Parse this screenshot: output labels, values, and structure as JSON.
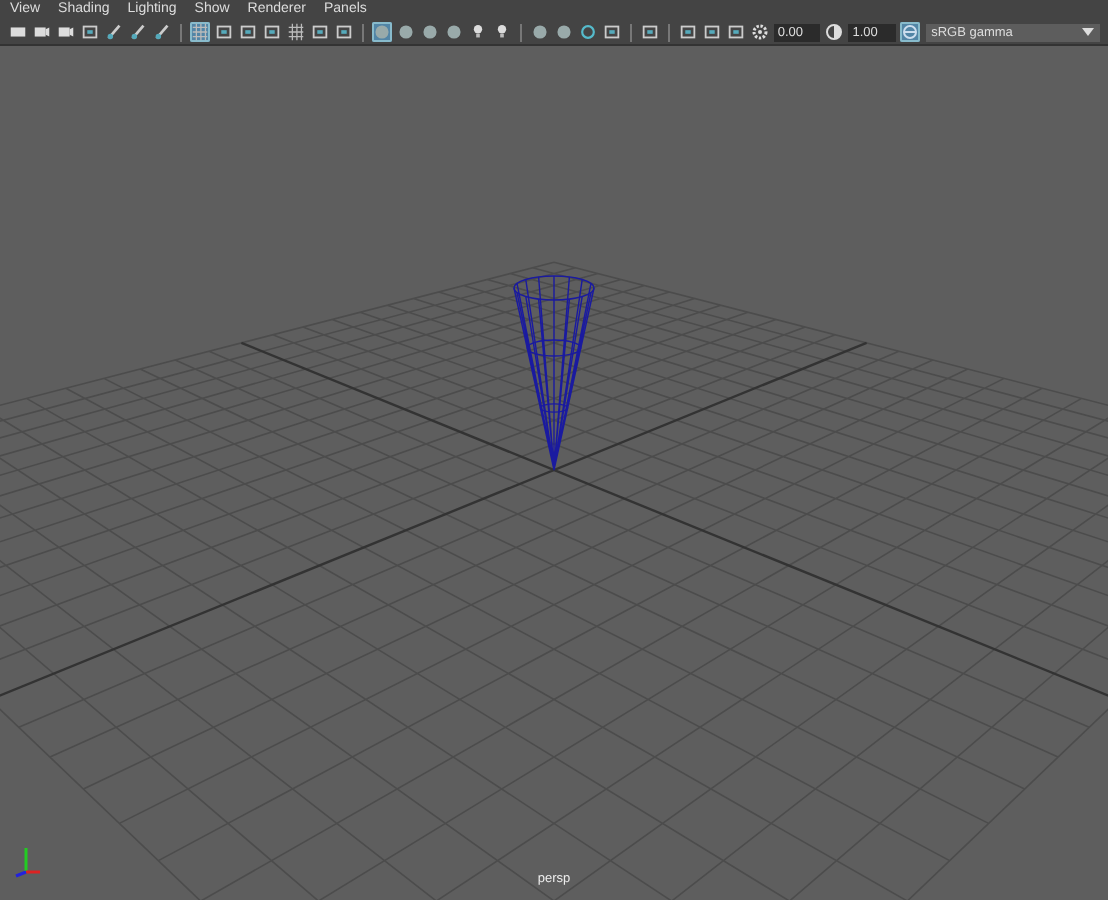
{
  "menu": [
    "View",
    "Shading",
    "Lighting",
    "Show",
    "Renderer",
    "Panels"
  ],
  "toolbar": {
    "groups": [
      [
        {
          "selected": false
        },
        {
          "selected": false
        },
        {
          "selected": false
        },
        {
          "selected": false
        },
        {
          "selected": false
        },
        {
          "selected": false
        },
        {
          "selected": false
        }
      ],
      [
        {
          "selected": true
        },
        {
          "selected": false
        },
        {
          "selected": false
        },
        {
          "selected": false
        },
        {
          "selected": false
        },
        {
          "selected": false
        },
        {
          "selected": false
        }
      ],
      [
        {
          "selected": true
        },
        {
          "selected": false
        },
        {
          "selected": false
        },
        {
          "selected": false
        },
        {
          "selected": false
        },
        {
          "selected": false
        }
      ],
      [
        {
          "selected": false
        },
        {
          "selected": false
        },
        {
          "selected": false
        },
        {
          "selected": false
        }
      ],
      [
        {
          "selected": false
        }
      ],
      [
        {
          "selected": false
        },
        {
          "selected": false
        },
        {
          "selected": false
        }
      ]
    ],
    "exposure": "0.00",
    "gamma": "1.00",
    "color_management": {
      "selected": true
    },
    "color_space": "sRGB gamma"
  },
  "viewport": {
    "camera_label": "persp"
  }
}
